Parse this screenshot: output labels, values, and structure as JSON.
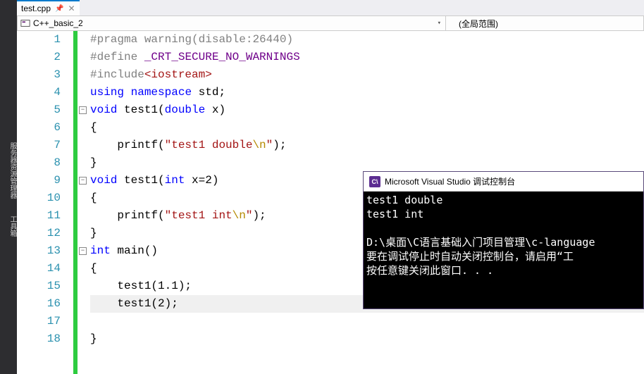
{
  "sidebar": {
    "label1": "服务器资源管理器",
    "label2": "工具箱"
  },
  "tab": {
    "filename": "test.cpp"
  },
  "navbar": {
    "project": "C++_basic_2",
    "scope": "(全局范围)"
  },
  "code": {
    "l1_a": "#pragma",
    "l1_b": " warning(disable:26440)",
    "l2_a": "#define",
    "l2_b": " ",
    "l2_c": "_CRT_SECURE_NO_WARNINGS",
    "l3_a": "#include",
    "l3_b": "<iostream>",
    "l4_a": "using",
    "l4_b": " ",
    "l4_c": "namespace",
    "l4_d": " std;",
    "l5_a": "void",
    "l5_b": " test1(",
    "l5_c": "double",
    "l5_d": " x)",
    "l6": "{",
    "l7_a": "    printf(",
    "l7_b": "\"test1 double",
    "l7_c": "\\n",
    "l7_d": "\"",
    "l7_e": ");",
    "l8": "}",
    "l9_a": "void",
    "l9_b": " test1(",
    "l9_c": "int",
    "l9_d": " x=2)",
    "l10": "{",
    "l11_a": "    printf(",
    "l11_b": "\"test1 int",
    "l11_c": "\\n",
    "l11_d": "\"",
    "l11_e": ");",
    "l12": "}",
    "l13_a": "int",
    "l13_b": " main()",
    "l14": "{",
    "l15": "    test1(1.1);",
    "l16": "    test1(2);",
    "l17": "",
    "l18": "}"
  },
  "lines": {
    "n1": "1",
    "n2": "2",
    "n3": "3",
    "n4": "4",
    "n5": "5",
    "n6": "6",
    "n7": "7",
    "n8": "8",
    "n9": "9",
    "n10": "10",
    "n11": "11",
    "n12": "12",
    "n13": "13",
    "n14": "14",
    "n15": "15",
    "n16": "16",
    "n17": "17",
    "n18": "18"
  },
  "console": {
    "title": "Microsoft Visual Studio 调试控制台",
    "out1": "test1 double",
    "out2": "test1 int",
    "out3": "",
    "out4": "D:\\桌面\\C语言基础入门项目管理\\c-language",
    "out5": "要在调试停止时自动关闭控制台，请启用“工",
    "out6": "按任意键关闭此窗口. . ."
  }
}
